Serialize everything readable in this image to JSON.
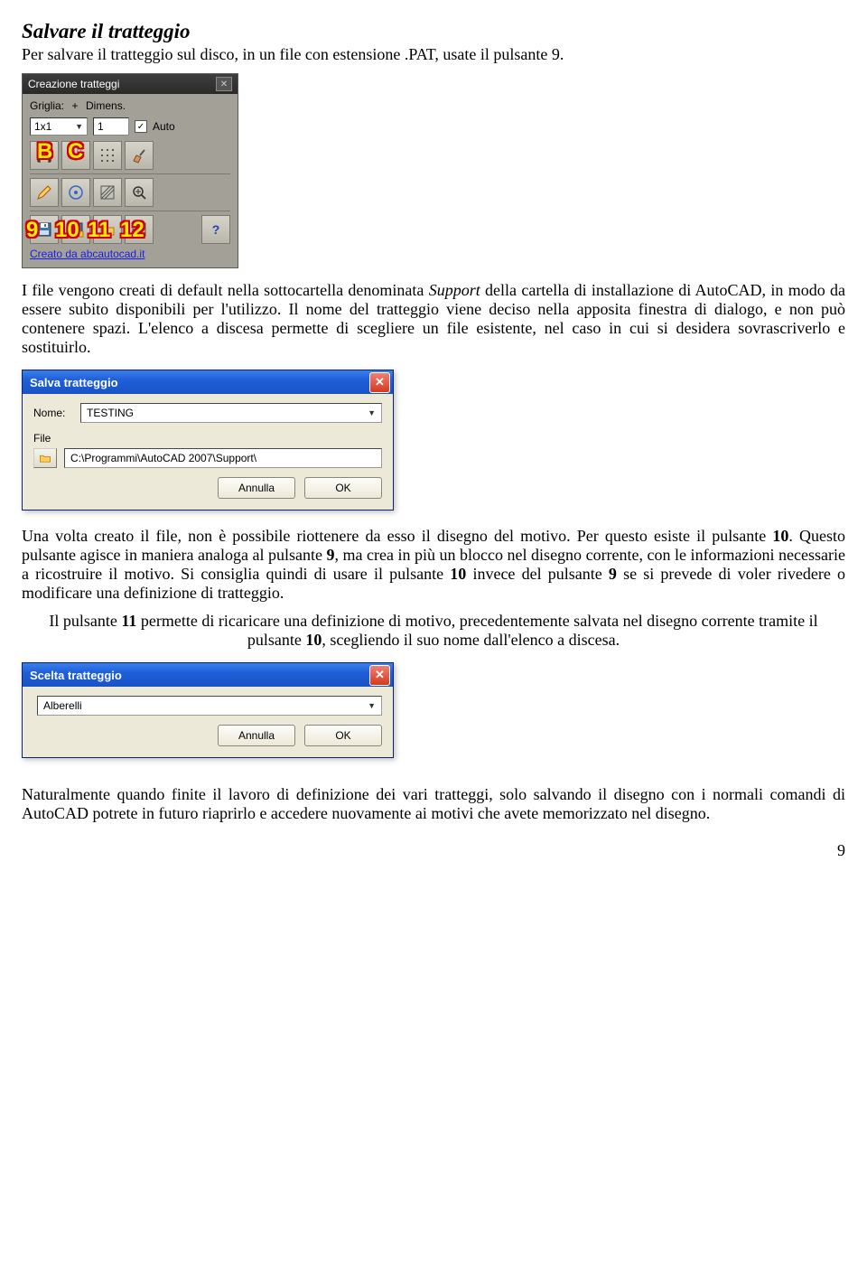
{
  "heading": "Salvare il tratteggio",
  "intro": "Per salvare il tratteggio sul disco, in un file con estensione .PAT, usate il pulsante 9.",
  "panel1": {
    "title": "Creazione tratteggi",
    "griglia_label": "Griglia:",
    "griglia_value": "1x1",
    "plus": "+",
    "dimens_label": "Dimens.",
    "dimens_value": "1",
    "auto_label": "Auto",
    "auto_check": "✓",
    "link": "Creato da abcautocad.it",
    "letters": {
      "B": "B",
      "C": "C",
      "n9": "9",
      "n10": "10",
      "n11": "11",
      "n12": "12"
    }
  },
  "para2_parts": [
    "I file vengono creati di default nella sottocartella denominata ",
    "Support",
    " della cartella di installazione di AutoCAD, in modo da essere subito disponibili per l'utilizzo. Il nome del tratteggio viene deciso nella apposita finestra di dialogo, e non può contenere spazi. L'elenco a discesa permette di scegliere un file esistente, nel caso in cui si desidera sovrascriverlo e sostituirlo."
  ],
  "dlgSave": {
    "title": "Salva tratteggio",
    "nome_label": "Nome:",
    "nome_value": "TESTING",
    "file_label": "File",
    "path": "C:\\Programmi\\AutoCAD 2007\\Support\\",
    "annulla": "Annulla",
    "ok": "OK"
  },
  "para3_parts": [
    "Una volta creato il file, non è possibile riottenere da esso il disegno del motivo. Per questo esiste il pulsante ",
    "10",
    ". Questo pulsante agisce in maniera analoga al pulsante ",
    "9",
    ", ma crea in più un blocco nel disegno corrente, con le informazioni necessarie a ricostruire il motivo. Si consiglia quindi di usare il pulsante ",
    "10",
    " invece del pulsante ",
    "9",
    " se si prevede di voler rivedere o modificare una definizione di tratteggio."
  ],
  "para4_parts": [
    "Il pulsante ",
    "11",
    " permette di ricaricare una definizione di motivo, precedentemente salvata nel disegno corrente tramite il pulsante ",
    "10",
    ", scegliendo il suo nome dall'elenco a discesa."
  ],
  "dlgPick": {
    "title": "Scelta tratteggio",
    "value": "Alberelli",
    "annulla": "Annulla",
    "ok": "OK"
  },
  "para5": "Naturalmente quando finite il lavoro di definizione dei vari tratteggi, solo salvando il disegno con i normali comandi di AutoCAD potrete in futuro riaprirlo e accedere nuovamente ai motivi che avete memorizzato nel disegno.",
  "page_number": "9"
}
